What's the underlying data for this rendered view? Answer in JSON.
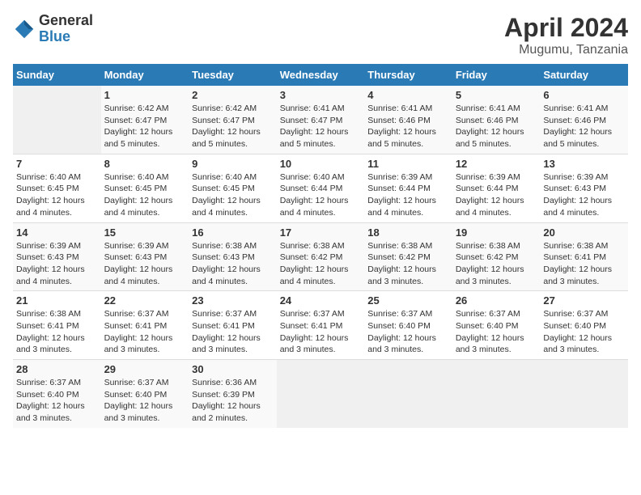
{
  "logo": {
    "general": "General",
    "blue": "Blue"
  },
  "title": "April 2024",
  "subtitle": "Mugumu, Tanzania",
  "days_header": [
    "Sunday",
    "Monday",
    "Tuesday",
    "Wednesday",
    "Thursday",
    "Friday",
    "Saturday"
  ],
  "weeks": [
    [
      {
        "num": "",
        "info": ""
      },
      {
        "num": "1",
        "info": "Sunrise: 6:42 AM\nSunset: 6:47 PM\nDaylight: 12 hours\nand 5 minutes."
      },
      {
        "num": "2",
        "info": "Sunrise: 6:42 AM\nSunset: 6:47 PM\nDaylight: 12 hours\nand 5 minutes."
      },
      {
        "num": "3",
        "info": "Sunrise: 6:41 AM\nSunset: 6:47 PM\nDaylight: 12 hours\nand 5 minutes."
      },
      {
        "num": "4",
        "info": "Sunrise: 6:41 AM\nSunset: 6:46 PM\nDaylight: 12 hours\nand 5 minutes."
      },
      {
        "num": "5",
        "info": "Sunrise: 6:41 AM\nSunset: 6:46 PM\nDaylight: 12 hours\nand 5 minutes."
      },
      {
        "num": "6",
        "info": "Sunrise: 6:41 AM\nSunset: 6:46 PM\nDaylight: 12 hours\nand 5 minutes."
      }
    ],
    [
      {
        "num": "7",
        "info": "Sunrise: 6:40 AM\nSunset: 6:45 PM\nDaylight: 12 hours\nand 4 minutes."
      },
      {
        "num": "8",
        "info": "Sunrise: 6:40 AM\nSunset: 6:45 PM\nDaylight: 12 hours\nand 4 minutes."
      },
      {
        "num": "9",
        "info": "Sunrise: 6:40 AM\nSunset: 6:45 PM\nDaylight: 12 hours\nand 4 minutes."
      },
      {
        "num": "10",
        "info": "Sunrise: 6:40 AM\nSunset: 6:44 PM\nDaylight: 12 hours\nand 4 minutes."
      },
      {
        "num": "11",
        "info": "Sunrise: 6:39 AM\nSunset: 6:44 PM\nDaylight: 12 hours\nand 4 minutes."
      },
      {
        "num": "12",
        "info": "Sunrise: 6:39 AM\nSunset: 6:44 PM\nDaylight: 12 hours\nand 4 minutes."
      },
      {
        "num": "13",
        "info": "Sunrise: 6:39 AM\nSunset: 6:43 PM\nDaylight: 12 hours\nand 4 minutes."
      }
    ],
    [
      {
        "num": "14",
        "info": "Sunrise: 6:39 AM\nSunset: 6:43 PM\nDaylight: 12 hours\nand 4 minutes."
      },
      {
        "num": "15",
        "info": "Sunrise: 6:39 AM\nSunset: 6:43 PM\nDaylight: 12 hours\nand 4 minutes."
      },
      {
        "num": "16",
        "info": "Sunrise: 6:38 AM\nSunset: 6:43 PM\nDaylight: 12 hours\nand 4 minutes."
      },
      {
        "num": "17",
        "info": "Sunrise: 6:38 AM\nSunset: 6:42 PM\nDaylight: 12 hours\nand 4 minutes."
      },
      {
        "num": "18",
        "info": "Sunrise: 6:38 AM\nSunset: 6:42 PM\nDaylight: 12 hours\nand 3 minutes."
      },
      {
        "num": "19",
        "info": "Sunrise: 6:38 AM\nSunset: 6:42 PM\nDaylight: 12 hours\nand 3 minutes."
      },
      {
        "num": "20",
        "info": "Sunrise: 6:38 AM\nSunset: 6:41 PM\nDaylight: 12 hours\nand 3 minutes."
      }
    ],
    [
      {
        "num": "21",
        "info": "Sunrise: 6:38 AM\nSunset: 6:41 PM\nDaylight: 12 hours\nand 3 minutes."
      },
      {
        "num": "22",
        "info": "Sunrise: 6:37 AM\nSunset: 6:41 PM\nDaylight: 12 hours\nand 3 minutes."
      },
      {
        "num": "23",
        "info": "Sunrise: 6:37 AM\nSunset: 6:41 PM\nDaylight: 12 hours\nand 3 minutes."
      },
      {
        "num": "24",
        "info": "Sunrise: 6:37 AM\nSunset: 6:41 PM\nDaylight: 12 hours\nand 3 minutes."
      },
      {
        "num": "25",
        "info": "Sunrise: 6:37 AM\nSunset: 6:40 PM\nDaylight: 12 hours\nand 3 minutes."
      },
      {
        "num": "26",
        "info": "Sunrise: 6:37 AM\nSunset: 6:40 PM\nDaylight: 12 hours\nand 3 minutes."
      },
      {
        "num": "27",
        "info": "Sunrise: 6:37 AM\nSunset: 6:40 PM\nDaylight: 12 hours\nand 3 minutes."
      }
    ],
    [
      {
        "num": "28",
        "info": "Sunrise: 6:37 AM\nSunset: 6:40 PM\nDaylight: 12 hours\nand 3 minutes."
      },
      {
        "num": "29",
        "info": "Sunrise: 6:37 AM\nSunset: 6:40 PM\nDaylight: 12 hours\nand 3 minutes."
      },
      {
        "num": "30",
        "info": "Sunrise: 6:36 AM\nSunset: 6:39 PM\nDaylight: 12 hours\nand 2 minutes."
      },
      {
        "num": "",
        "info": ""
      },
      {
        "num": "",
        "info": ""
      },
      {
        "num": "",
        "info": ""
      },
      {
        "num": "",
        "info": ""
      }
    ]
  ]
}
